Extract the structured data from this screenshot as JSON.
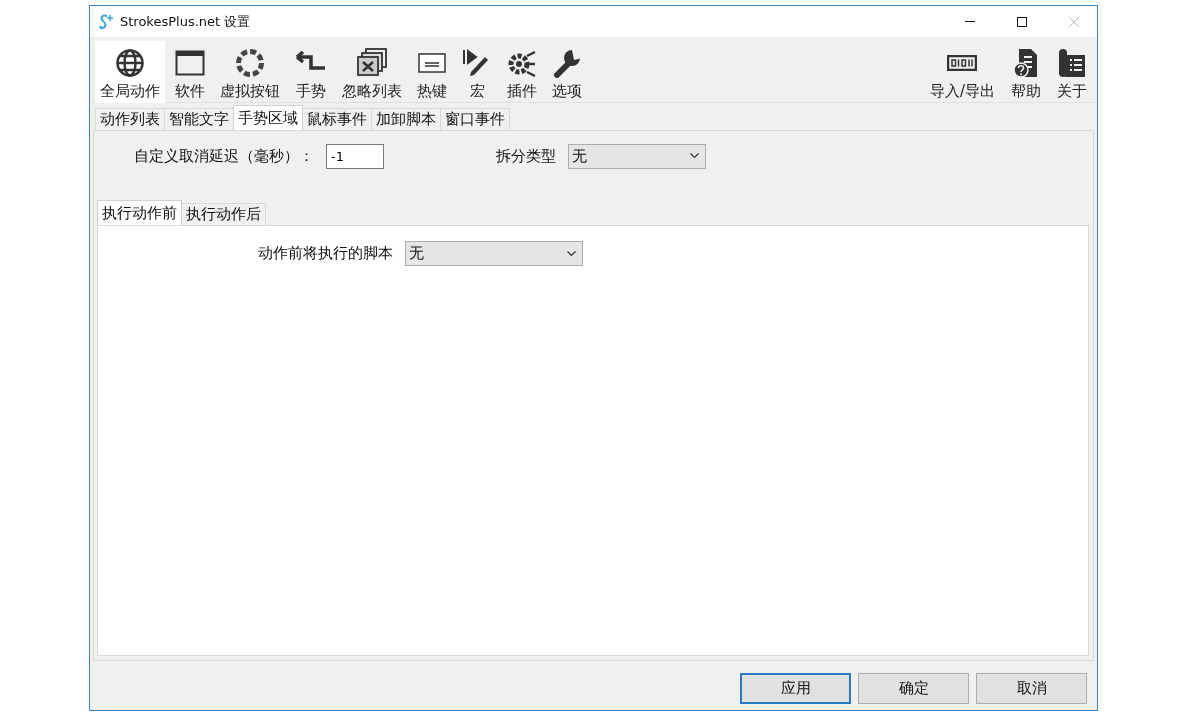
{
  "window": {
    "title": "StrokesPlus.net 设置"
  },
  "toolbar": {
    "left": [
      {
        "label": "全局动作",
        "selected": true
      },
      {
        "label": "软件",
        "selected": false
      },
      {
        "label": "虚拟按钮",
        "selected": false
      },
      {
        "label": "手势",
        "selected": false
      },
      {
        "label": "忽略列表",
        "selected": false
      },
      {
        "label": "热键",
        "selected": false
      },
      {
        "label": "宏",
        "selected": false
      },
      {
        "label": "插件",
        "selected": false
      },
      {
        "label": "选项",
        "selected": false
      }
    ],
    "right": [
      {
        "label": "导入/导出",
        "selected": false
      },
      {
        "label": "帮助",
        "selected": false
      },
      {
        "label": "关于",
        "selected": false
      }
    ]
  },
  "tabs": [
    {
      "label": "动作列表",
      "selected": false
    },
    {
      "label": "智能文字",
      "selected": false
    },
    {
      "label": "手势区域",
      "selected": true
    },
    {
      "label": "鼠标事件",
      "selected": false
    },
    {
      "label": "加卸脚本",
      "selected": false
    },
    {
      "label": "窗口事件",
      "selected": false
    }
  ],
  "options": {
    "cancel_delay": {
      "label": "自定义取消延迟（毫秒）：",
      "value": "-1"
    },
    "split_type": {
      "label": "拆分类型",
      "value": "无"
    }
  },
  "sub_tabs": [
    {
      "label": "执行动作前",
      "selected": true
    },
    {
      "label": "执行动作后",
      "selected": false
    }
  ],
  "script_before": {
    "label": "动作前将执行的脚本",
    "value": "无"
  },
  "buttons": [
    {
      "label": "应用",
      "default": true
    },
    {
      "label": "确定",
      "default": false
    },
    {
      "label": "取消",
      "default": false
    }
  ]
}
